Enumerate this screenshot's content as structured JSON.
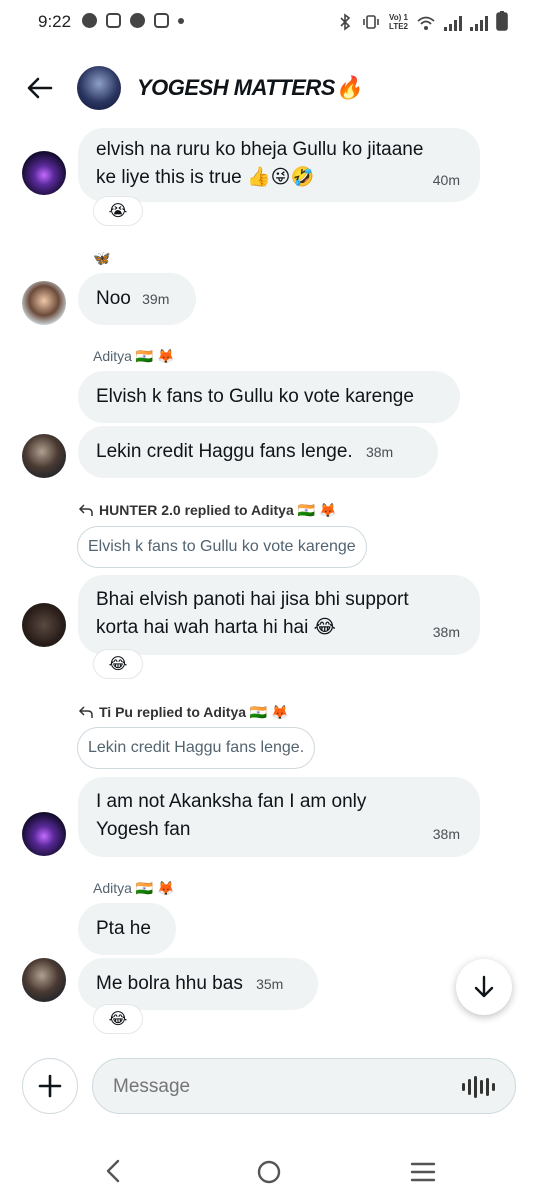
{
  "status_bar": {
    "time": "9:22",
    "network_label_top": "Vo) 1",
    "network_label_bottom": "LTE2"
  },
  "header": {
    "title": "YOGESH MATTERS🔥"
  },
  "messages": [
    {
      "text_line1": "elvish na ruru ko bheja Gullu ko jitaane",
      "text_line2": "ke liye this is true 👍😜🤣",
      "time": "40m",
      "reaction": "😭"
    },
    {
      "sender_icon": "🦋",
      "text": "Noo",
      "time": "39m"
    },
    {
      "sender": "Aditya 🇮🇳 🦊",
      "text": "Elvish k fans to Gullu ko vote karenge"
    },
    {
      "text": "Lekin credit Haggu fans lenge.",
      "time": "38m"
    },
    {
      "reply_header": "HUNTER 2.0 replied to Aditya 🇮🇳 🦊",
      "quote": "Elvish k fans to Gullu ko vote karenge",
      "text_line1": "Bhai elvish panoti hai jisa bhi support",
      "text_line2": "korta hai wah harta hi hai 😂",
      "time": "38m",
      "reaction": "😂"
    },
    {
      "reply_header": "Ti Pu replied to Aditya 🇮🇳 🦊",
      "quote": "Lekin credit Haggu fans lenge.",
      "text_line1": "I am not Akanksha fan I am only",
      "text_line2": "Yogesh fan",
      "time": "38m"
    },
    {
      "sender": "Aditya 🇮🇳 🦊",
      "text": "Pta he"
    },
    {
      "text": "Me bolra hhu bas",
      "time": "35m",
      "reaction": "😂"
    }
  ],
  "composer": {
    "placeholder": "Message"
  }
}
